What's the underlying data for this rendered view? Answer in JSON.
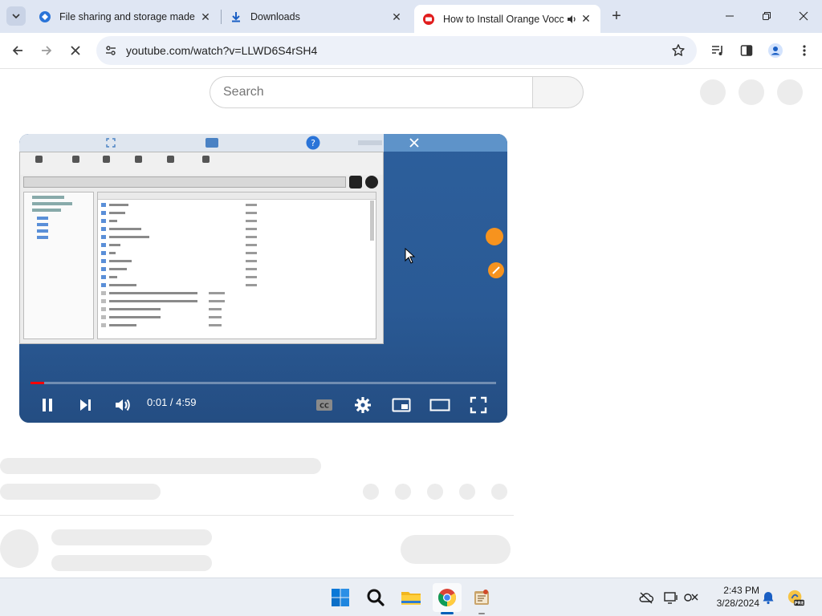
{
  "browser": {
    "tabs": [
      {
        "title": "File sharing and storage made"
      },
      {
        "title": "Downloads"
      },
      {
        "title": "How to Install Orange Vocc"
      }
    ],
    "url": "youtube.com/watch?v=LLWD6S4rSH4"
  },
  "youtube": {
    "search_placeholder": "Search",
    "player": {
      "time": "0:01 / 4:59",
      "progress": 0.03,
      "playing": true
    }
  },
  "taskbar": {
    "time": "2:43 PM",
    "date": "3/28/2024",
    "apps": [
      "start",
      "search",
      "file-explorer",
      "chrome",
      "app"
    ]
  },
  "colors": {
    "tabstrip": "#dfe6f3",
    "omnibox": "#edf1f9",
    "youtube_red": "#ff0000",
    "taskbar": "#eaeef4"
  }
}
